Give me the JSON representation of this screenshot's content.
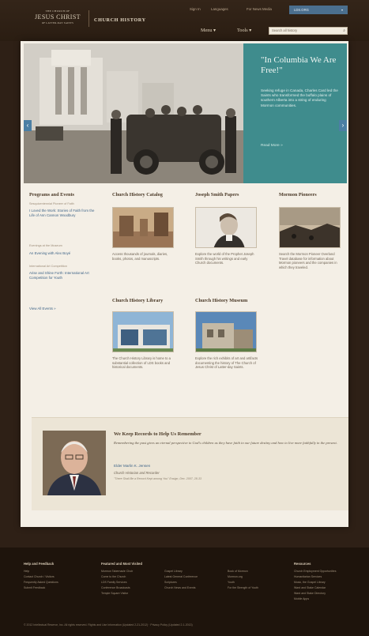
{
  "header": {
    "logo_line1": "THE CHURCH OF",
    "logo_line2": "JESUS CHRIST",
    "logo_line3": "OF LATTER-DAY SAINTS",
    "site_title": "CHURCH HISTORY",
    "sign_in": "Sign In",
    "languages": "Languages",
    "for_news_media": "For News Media",
    "utility_button": "LDS.ORG",
    "nav_menu": "Menu",
    "nav_tools": "Tools",
    "search_placeholder": "Search all history"
  },
  "hero": {
    "heading": "\"In Columbia We Are Free!\"",
    "body": "Seeking refuge in Canada, Charles Card led the Saints who transformed the buffalo plains of southern Alberta into a string of enduring Mormon communities.",
    "read_more": "Read More"
  },
  "events": {
    "heading": "Programs and Events",
    "groups": [
      {
        "sub": "Sesquicentennial Pioneer of Faith",
        "link": "I Loved the Work: Stories of Faith from the Life of Ann Cannon Woodbury"
      },
      {
        "sub": "Evenings at the Museum",
        "link": "An Evening with Alex Boyé"
      },
      {
        "sub": "International Art Competition",
        "link": "Arise and Shine Forth: International Art Competition for Youth"
      }
    ],
    "view_all": "View All Events"
  },
  "cards": [
    {
      "title": "Church History Catalog",
      "text": "Access thousands of journals, diaries, books, photos, and manuscripts."
    },
    {
      "title": "Joseph Smith Papers",
      "text": "Explore the world of the Prophet Joseph Smith through his writings and early Church documents."
    },
    {
      "title": "Mormon Pioneers",
      "text": "Search the Mormon Pioneer Overland Travel database for information about Mormon pioneers and the companies in which they traveled."
    },
    {
      "title": "Church History Library",
      "text": "The Church History Library is home to a substantial collection of LDS books and historical documents."
    },
    {
      "title": "Church History Museum",
      "text": "Explore the rich exhibits of art and artifacts documenting the history of The Church of Jesus Christ of Latter-day Saints."
    }
  ],
  "quote": {
    "title": "We Keep Records to Help Us Remember",
    "body": "Remembering the past gives an eternal perspective to God's children as they have faith in our future destiny and how to live more faithfully in the present.",
    "name": "Elder Marlin K. Jensen",
    "role": "Church Historian and Recorder",
    "source": "\"There Shall Be a Record Kept among You\" Ensign, Dec. 2007, 28-33"
  },
  "footer": {
    "columns": [
      {
        "heading": "Help and Feedback",
        "items": [
          "Help",
          "Contact Church / Visitors",
          "Frequently Asked Questions",
          "Submit Feedback"
        ]
      },
      {
        "heading": "Featured and Most Visited",
        "items": [
          "Mormon Tabernacle Choir",
          "Come to the Church",
          "LDS Family Services",
          "Conference Broadcasts",
          "Temple Square Visitor"
        ]
      },
      {
        "heading": "",
        "items": [
          "Gospel Library",
          "Latest General Conference",
          "Scriptures",
          "Church News and Events"
        ]
      },
      {
        "heading": "",
        "items": [
          "Book of Mormon",
          "Mormon.org",
          "Youth",
          "For the Strength of Youth"
        ]
      },
      {
        "heading": "Resources",
        "items": [
          "Church Employment Opportunities",
          "Humanitarian Services",
          "Music, the Gospel Library",
          "Ward and Stake Calendar",
          "Ward and Stake Directory",
          "Mobile Apps"
        ]
      }
    ],
    "copyright": "© 2012 Intellectual Reserve, Inc. All rights reserved. Rights and Use Information (Updated 2-21-2012) · Privacy Policy (Updated 2-1-2013)"
  }
}
